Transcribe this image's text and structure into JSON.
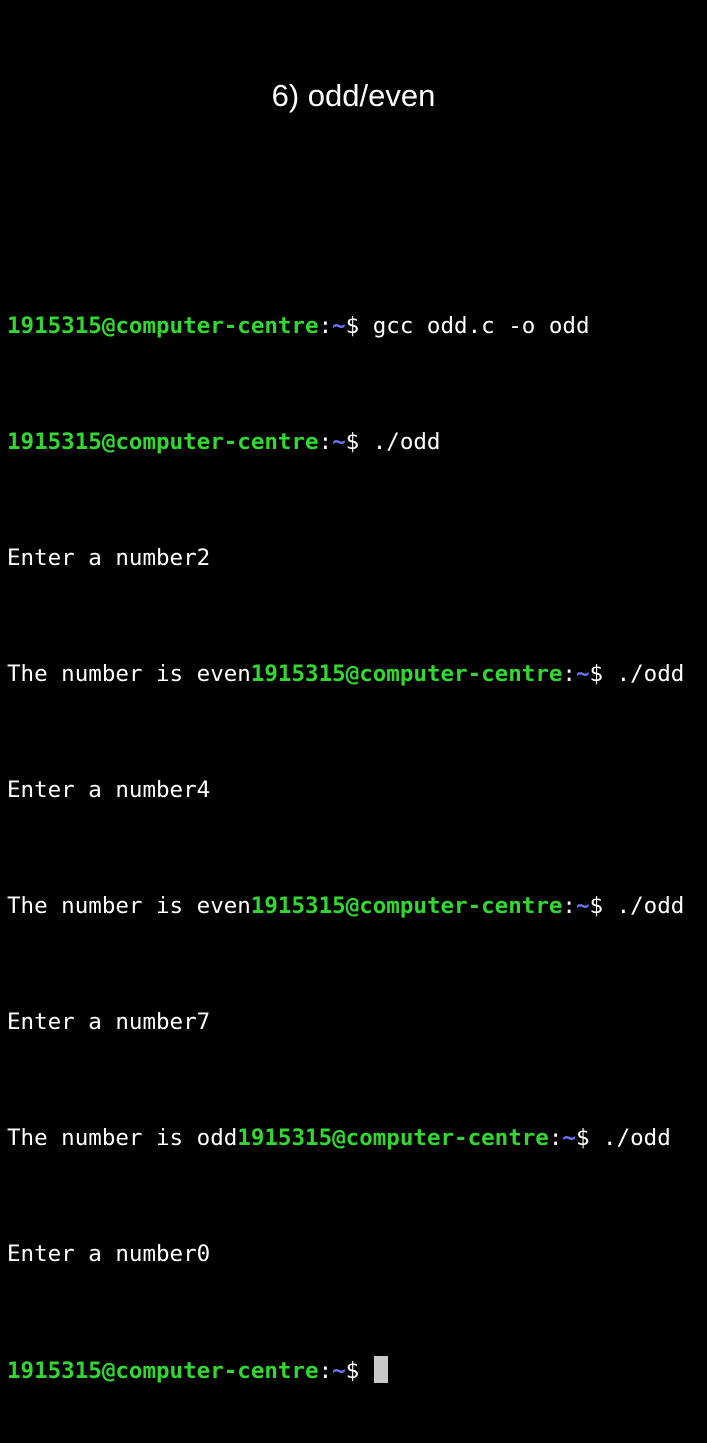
{
  "title": "6) odd/even",
  "prompt": {
    "user_host": "1915315@computer-centre",
    "colon": ":",
    "path": "~",
    "symbol": "$ "
  },
  "lines": {
    "l1_cmd": "gcc odd.c -o odd",
    "l2_cmd": "./odd",
    "l3_out": "Enter a number2",
    "l4_out": "The number is even",
    "l4_cmd": "./odd",
    "l5_out": "Enter a number4",
    "l6_out": "The number is even",
    "l6_cmd": "./odd",
    "l7_out": "Enter a number7",
    "l8_out": "The number is odd",
    "l8_cmd": "./odd",
    "l9_out": "Enter a number0"
  },
  "colors": {
    "background": "#000000",
    "prompt_user": "#33d633",
    "prompt_path": "#6b74ff",
    "text": "#ffffff",
    "cursor": "#c8c8c8"
  }
}
